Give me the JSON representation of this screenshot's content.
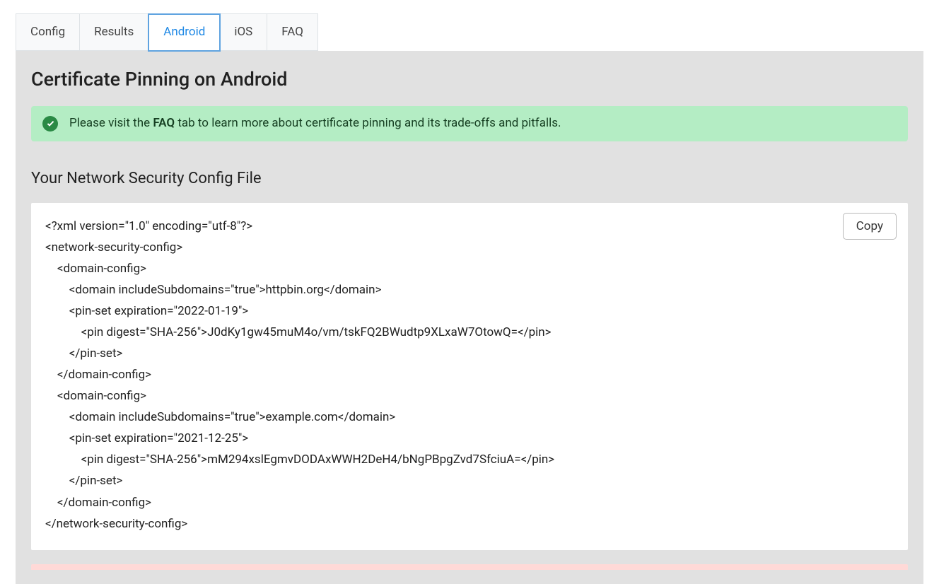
{
  "tabs": [
    {
      "label": "Config",
      "active": false
    },
    {
      "label": "Results",
      "active": false
    },
    {
      "label": "Android",
      "active": true
    },
    {
      "label": "iOS",
      "active": false
    },
    {
      "label": "FAQ",
      "active": false
    }
  ],
  "main": {
    "title": "Certificate Pinning on Android",
    "notice_prefix": "Please visit the ",
    "notice_strong": "FAQ",
    "notice_suffix": " tab to learn more about certificate pinning and its trade-offs and pitfalls.",
    "section_title": "Your Network Security Config File",
    "copy_label": "Copy",
    "config_xml": "<?xml version=\"1.0\" encoding=\"utf-8\"?>\n<network-security-config>\n    <domain-config>\n        <domain includeSubdomains=\"true\">httpbin.org</domain>\n        <pin-set expiration=\"2022-01-19\">\n            <pin digest=\"SHA-256\">J0dKy1gw45muM4o/vm/tskFQ2BWudtp9XLxaW7OtowQ=</pin>\n        </pin-set>\n    </domain-config>\n    <domain-config>\n        <domain includeSubdomains=\"true\">example.com</domain>\n        <pin-set expiration=\"2021-12-25\">\n            <pin digest=\"SHA-256\">mM294xslEgmvDODAxWWH2DeH4/bNgPBpgZvd7SfciuA=</pin>\n        </pin-set>\n    </domain-config>\n</network-security-config>"
  }
}
